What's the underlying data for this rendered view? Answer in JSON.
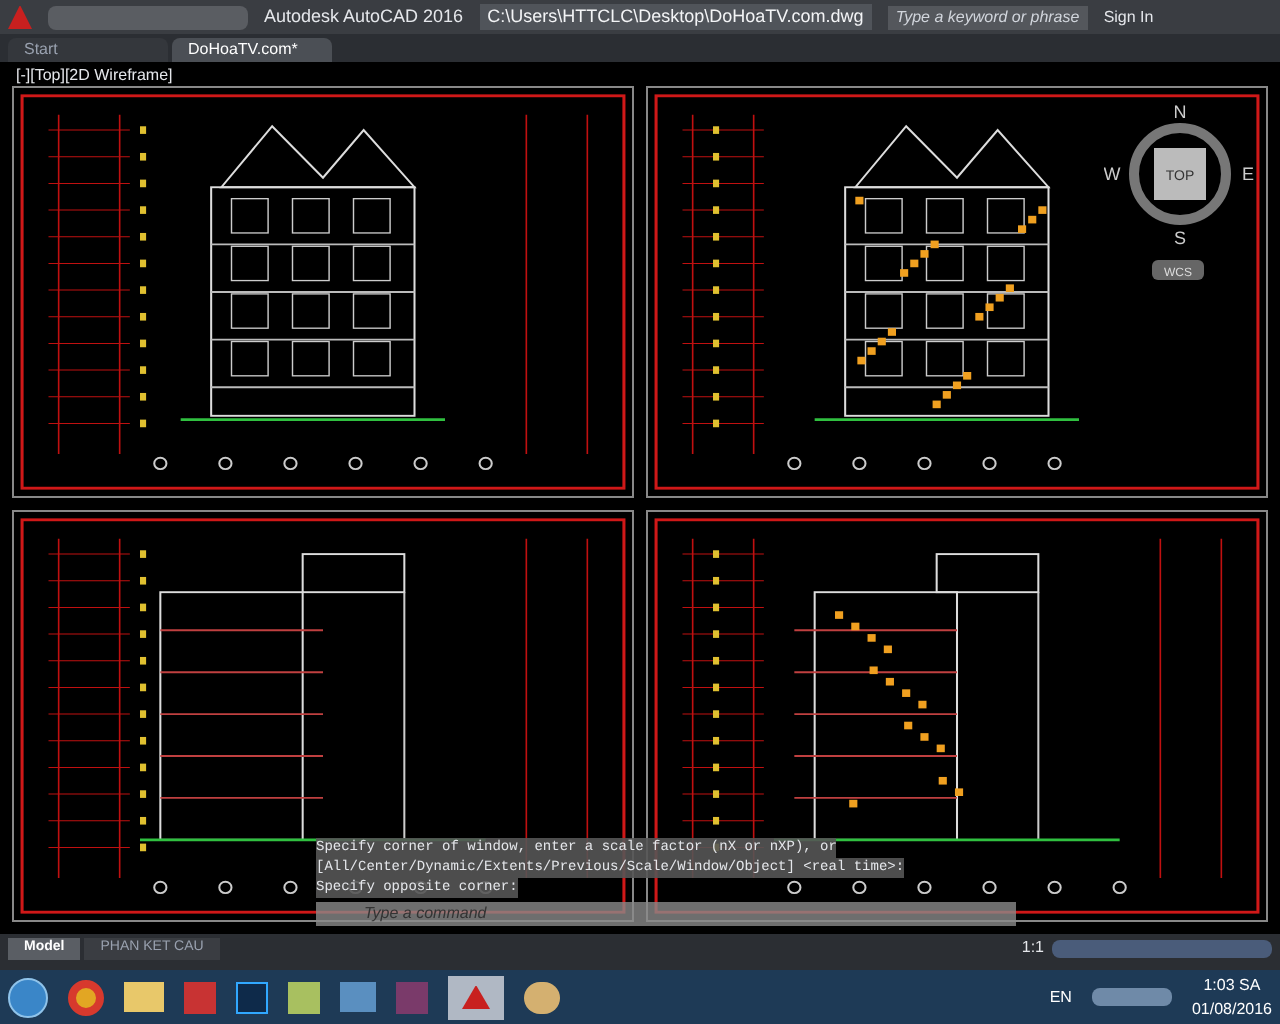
{
  "window": {
    "title": "Autodesk AutoCAD 2016",
    "file_path": "C:\\Users\\HTTCLC\\Desktop\\DoHoaTV.com.dwg"
  },
  "search": {
    "placeholder": "Type a keyword or phrase"
  },
  "sign_in": "Sign In",
  "doc_tabs": [
    {
      "label": "Start",
      "selected": false
    },
    {
      "label": "DoHoaTV.com*",
      "selected": true
    }
  ],
  "viewport_label": "[-][Top][2D Wireframe]",
  "viewcube": {
    "face": "TOP",
    "north": "N",
    "south": "S",
    "east": "E",
    "west": "W",
    "ucs": "WCS"
  },
  "command_history": [
    "Specify corner of window, enter a scale factor (nX or nXP), or",
    "[All/Center/Dynamic/Extents/Previous/Scale/Window/Object] <real time>:",
    "Specify opposite corner:"
  ],
  "command_prompt": {
    "placeholder": "Type a command"
  },
  "layout_tabs": [
    {
      "label": "Model",
      "selected": true
    },
    {
      "label": "PHAN KET CAU",
      "selected": false
    }
  ],
  "status_bar": {
    "scale": "1:1"
  },
  "taskbar": {
    "language": "EN",
    "time": "1:03 SA",
    "date": "01/08/2016"
  }
}
